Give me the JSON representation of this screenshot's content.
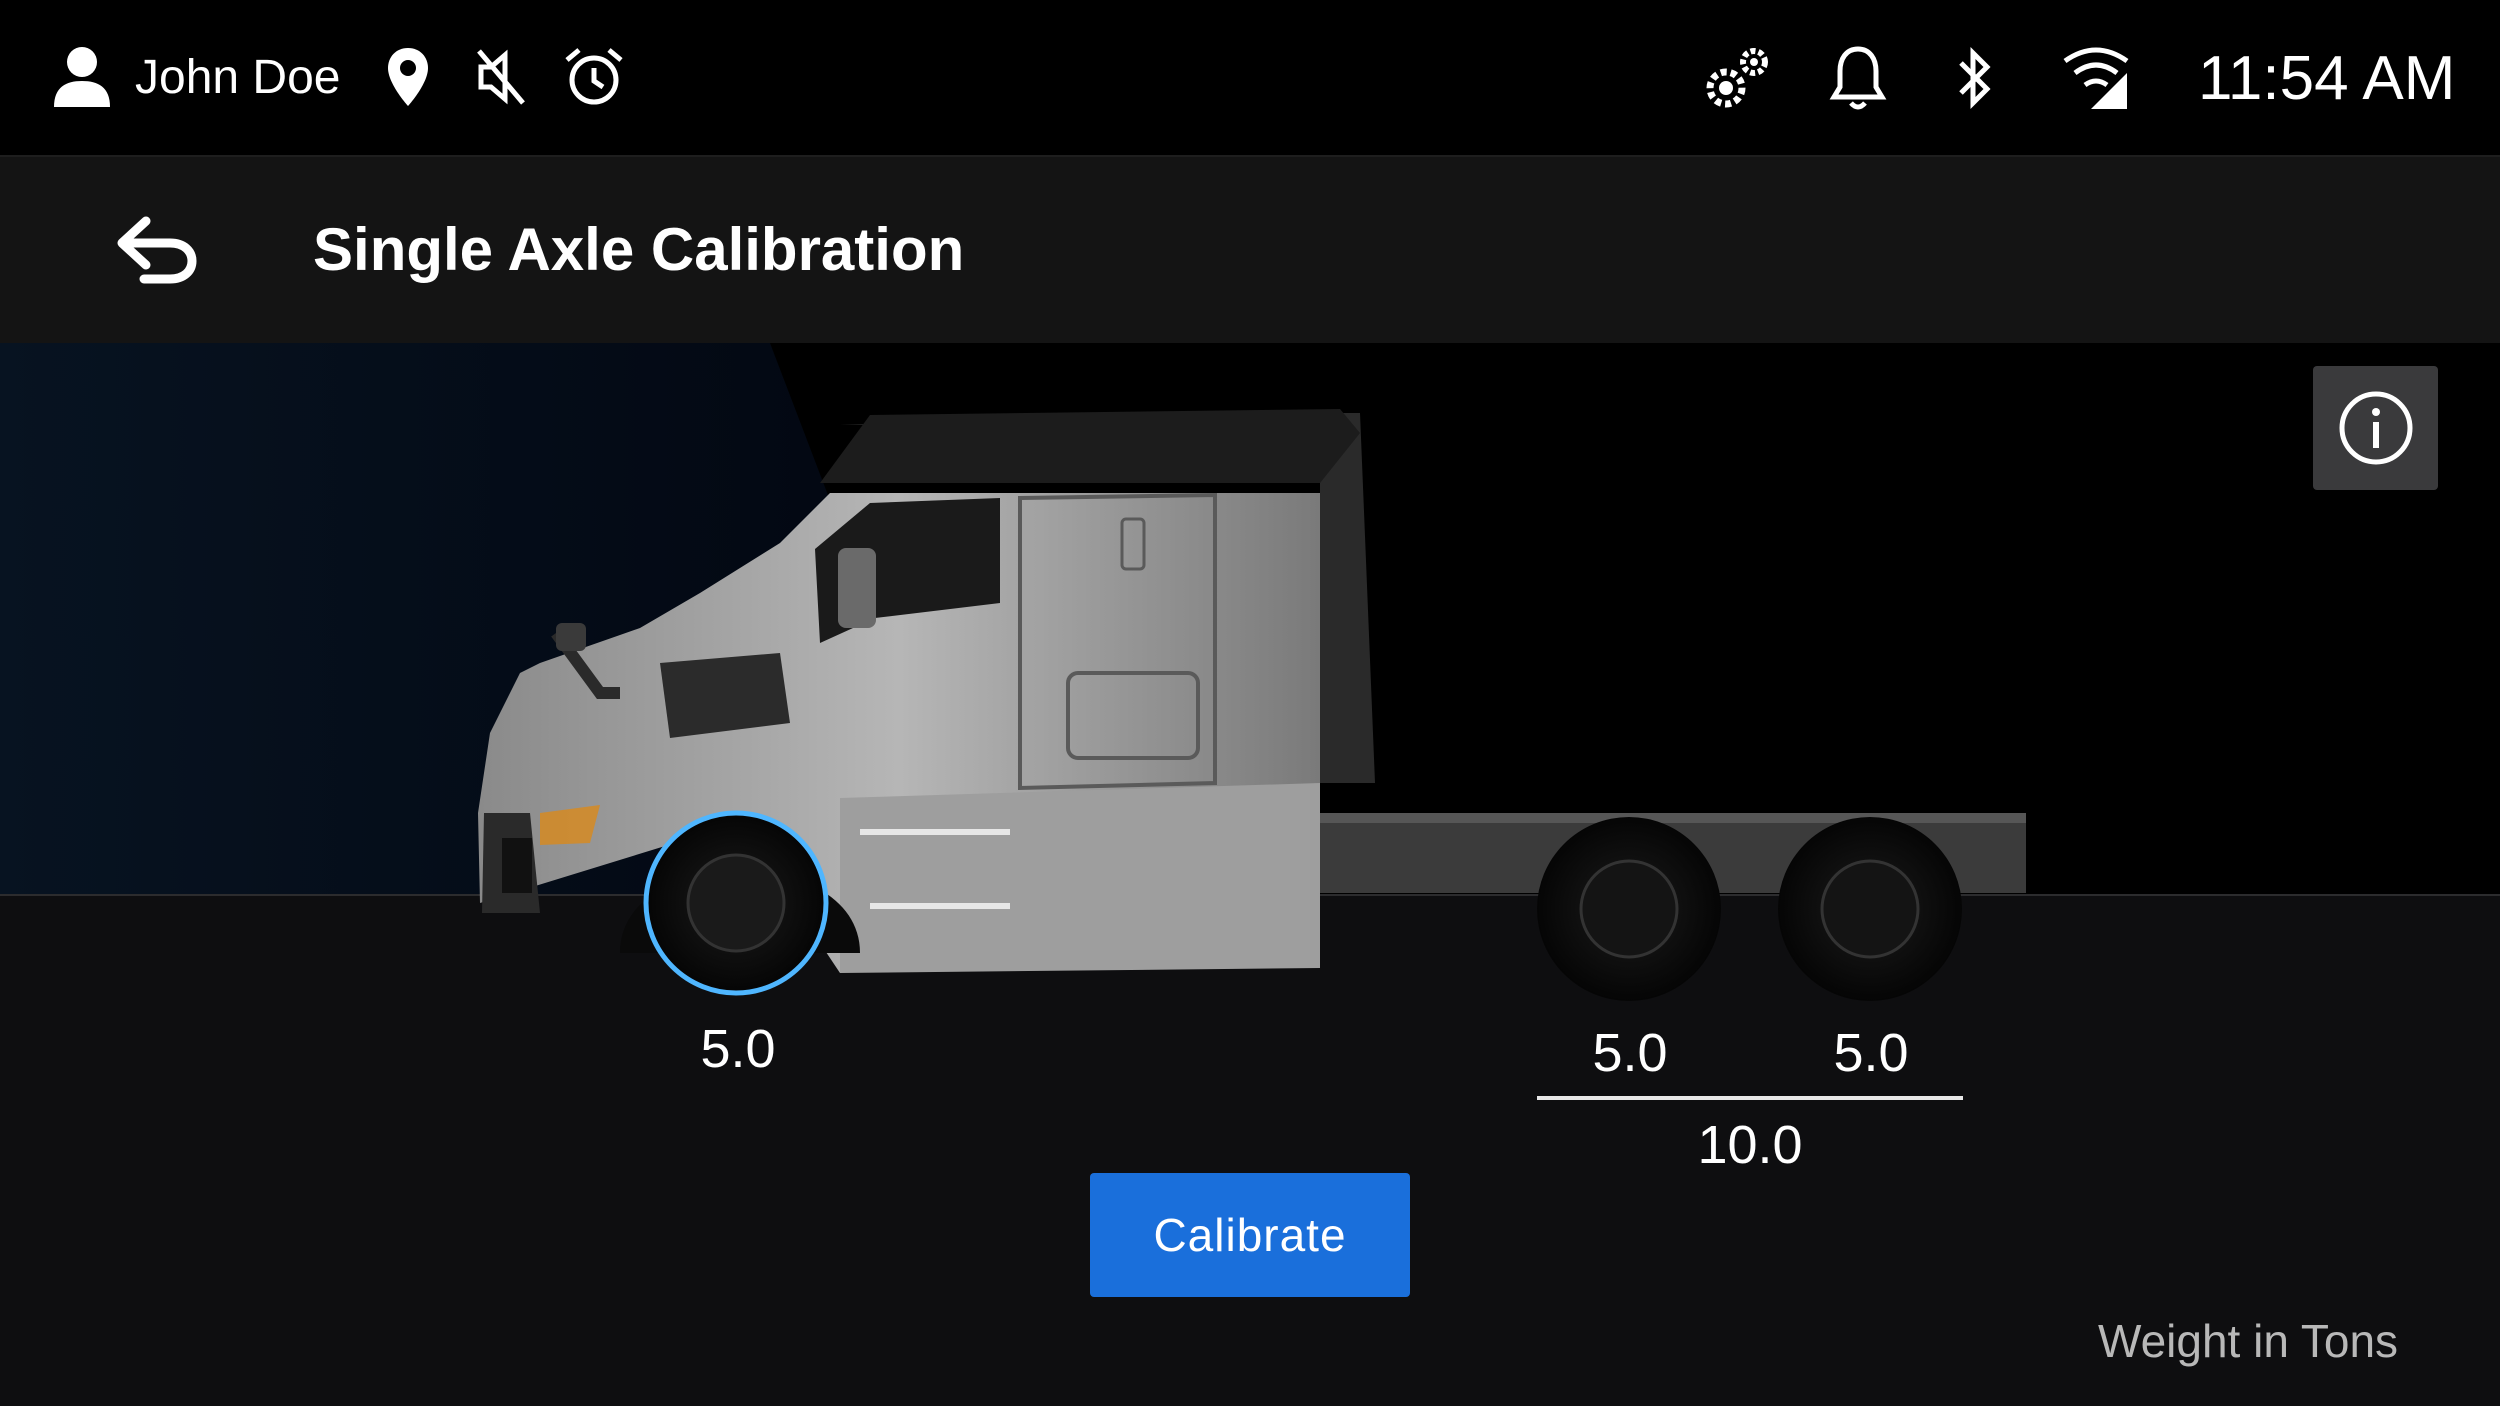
{
  "status_bar": {
    "user_name": "John Doe",
    "time": "11:54 AM",
    "icons": [
      "user-icon",
      "location-icon",
      "mute-icon",
      "alarm-icon",
      "settings-gears-icon",
      "bell-icon",
      "bluetooth-icon",
      "cellular-signal-icon"
    ]
  },
  "header": {
    "back_icon": "back-arrow-icon",
    "title": "Single Axle Calibration"
  },
  "info_icon": "info-icon",
  "axles": {
    "front": "5.0",
    "rear_1": "5.0",
    "rear_2": "5.0",
    "rear_total": "10.0"
  },
  "calibrate_label": "Calibrate",
  "units_label": "Weight in Tons",
  "colors": {
    "accent_blue": "#1a6fdb",
    "wheel_highlight": "#4fb6ff"
  }
}
